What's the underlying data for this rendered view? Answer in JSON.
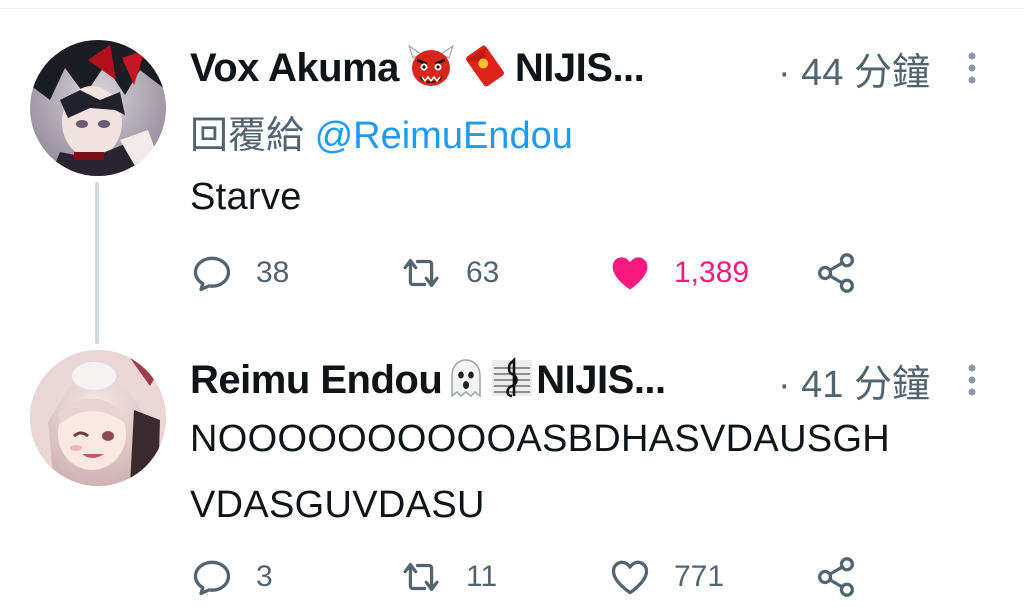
{
  "tweets": [
    {
      "display_name": "Vox Akuma",
      "affiliation": "NIJIS...",
      "time": "· 44 分鐘",
      "reply_prefix": "回覆給",
      "reply_mention": "@ReimuEndou",
      "text": "Starve",
      "replies": "38",
      "retweets": "63",
      "likes": "1,389",
      "liked": true,
      "emoji_icons": [
        "oni-icon",
        "red-envelope-icon"
      ]
    },
    {
      "display_name": "Reimu Endou",
      "affiliation": "NIJIS...",
      "time": "· 41 分鐘",
      "text_line1": "NOOOOOOOOOOASBDHASVDAUSGH",
      "text_line2": "VDASGUVDASU",
      "replies": "3",
      "retweets": "11",
      "likes": "771",
      "liked": false,
      "emoji_icons": [
        "ghost-icon",
        "sheet-music-icon"
      ]
    }
  ],
  "colors": {
    "text": "#0f1419",
    "secondary": "#536471",
    "mention": "#1d9bf0",
    "like_active": "#f91880",
    "thread_line": "#cfd9de"
  }
}
